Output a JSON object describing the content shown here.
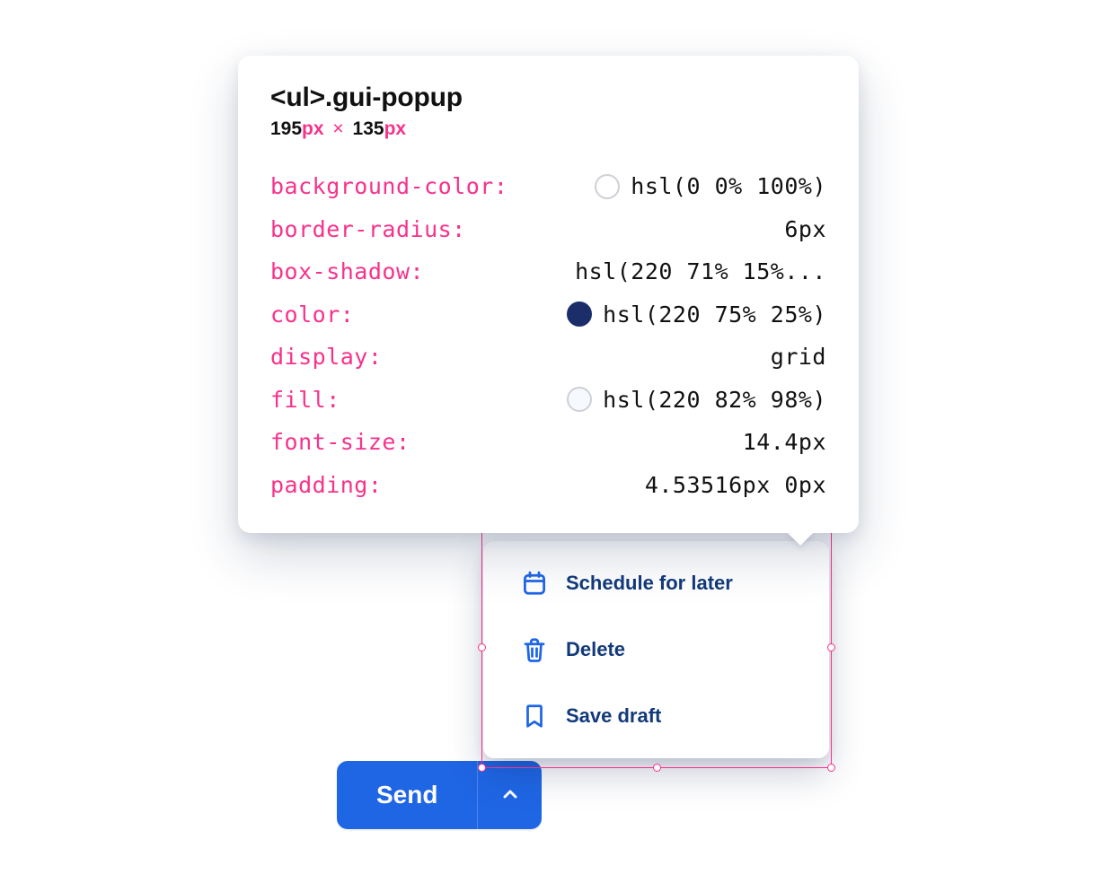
{
  "tooltip": {
    "selector": "<ul>.gui-popup",
    "width_number": "195",
    "height_number": "135",
    "unit": "px",
    "times": "×",
    "props": {
      "background_color": {
        "prop": "background-color",
        "value": "hsl(0 0% 100%)"
      },
      "border_radius": {
        "prop": "border-radius",
        "value": "6px"
      },
      "box_shadow": {
        "prop": "box-shadow",
        "value": "hsl(220 71% 15%..."
      },
      "color": {
        "prop": "color",
        "value": "hsl(220 75% 25%)"
      },
      "display": {
        "prop": "display",
        "value": "grid"
      },
      "fill": {
        "prop": "fill",
        "value": "hsl(220 82% 98%)"
      },
      "font_size": {
        "prop": "font-size",
        "value": "14.4px"
      },
      "padding": {
        "prop": "padding",
        "value": "4.53516px 0px"
      }
    }
  },
  "popup": {
    "items": [
      {
        "label": "Schedule for later"
      },
      {
        "label": "Delete"
      },
      {
        "label": "Save draft"
      }
    ]
  },
  "send": {
    "label": "Send"
  }
}
